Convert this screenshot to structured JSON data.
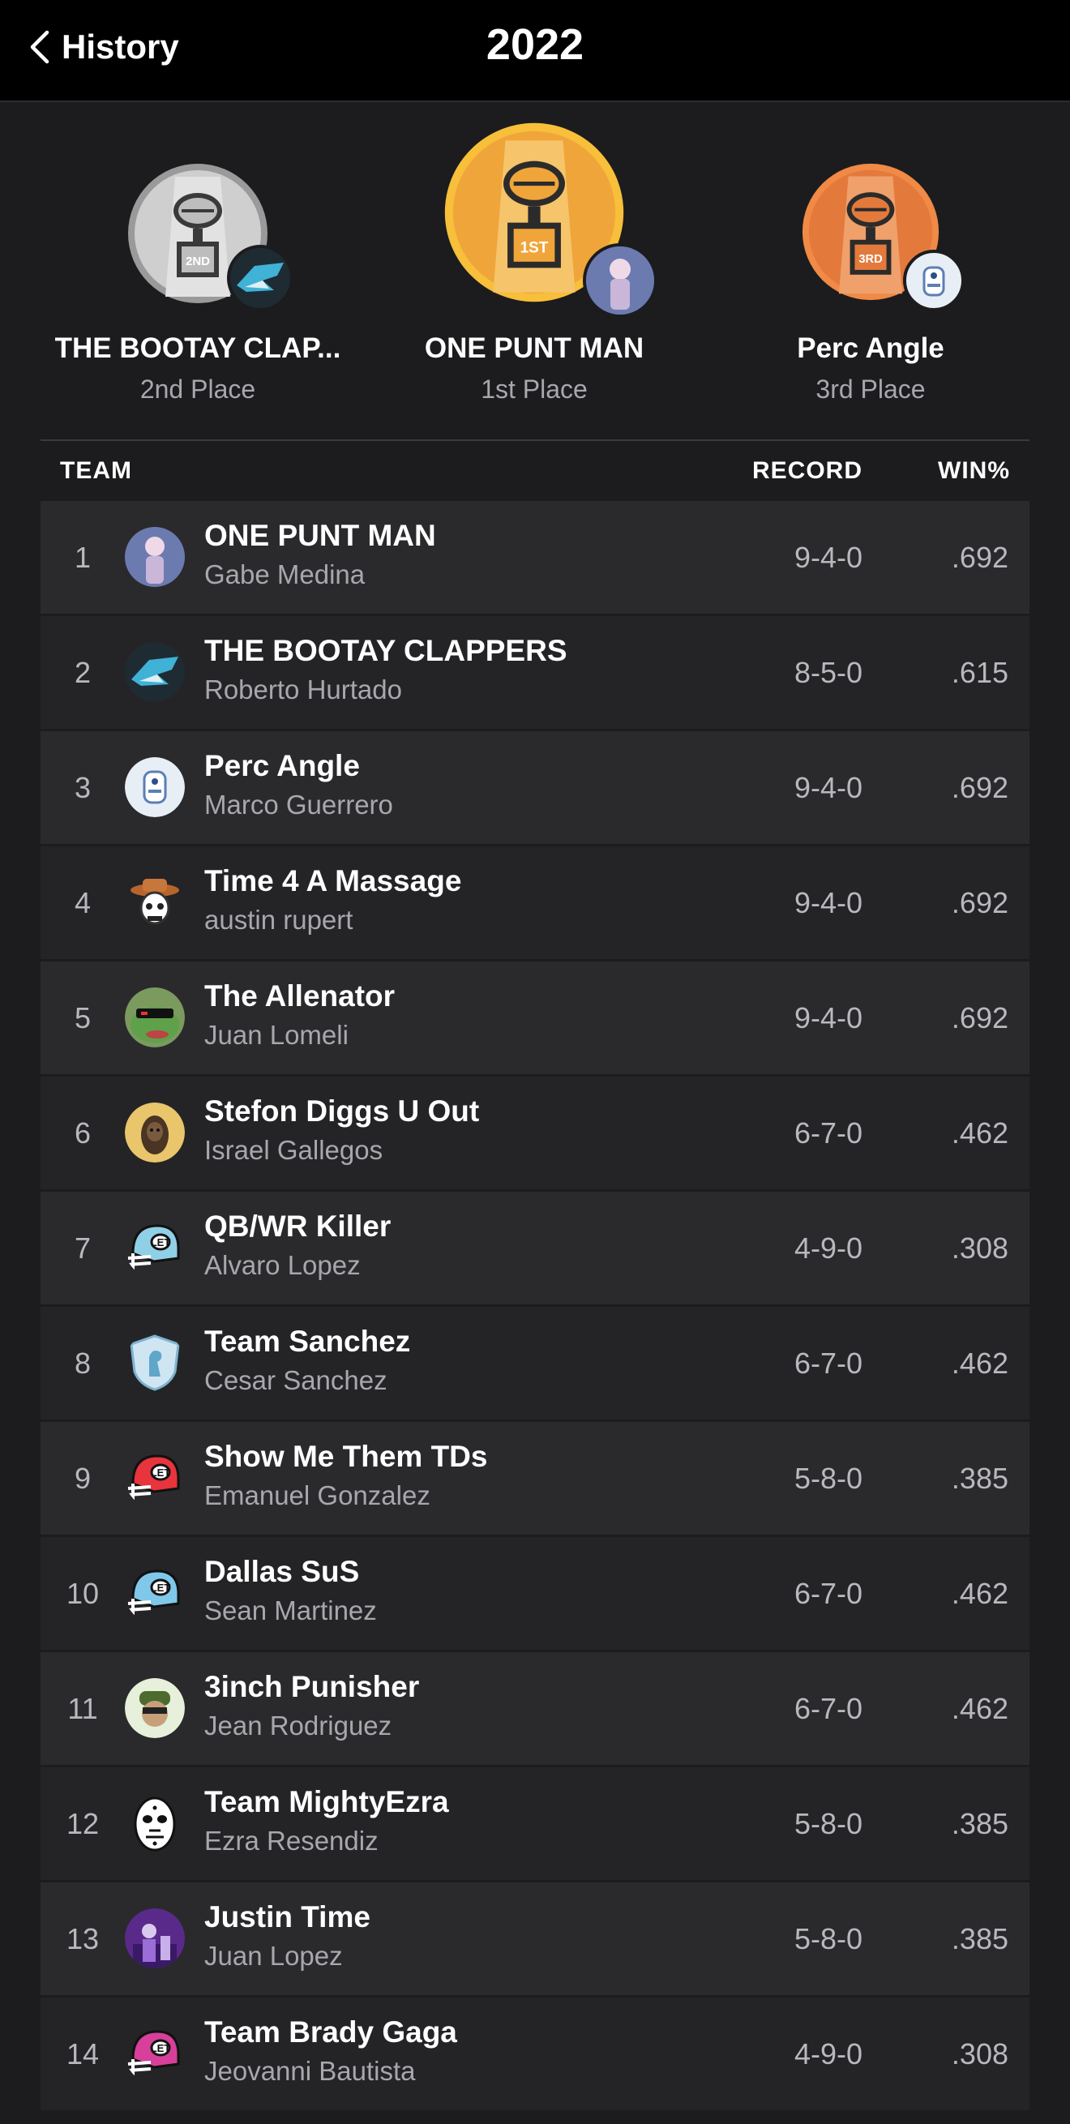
{
  "header": {
    "back_label": "History",
    "title": "2022"
  },
  "podium": [
    {
      "team": "THE BOOTAY CLAP...",
      "place": "2nd Place",
      "medal": "2ND",
      "color": "#bdbdbd"
    },
    {
      "team": "ONE PUNT MAN",
      "place": "1st Place",
      "medal": "1ST",
      "color": "#f0a53a"
    },
    {
      "team": "Perc Angle",
      "place": "3rd Place",
      "medal": "3RD",
      "color": "#e37a3b"
    }
  ],
  "table": {
    "headers": {
      "team": "TEAM",
      "record": "RECORD",
      "win_pct": "WIN%"
    },
    "rows": [
      {
        "rank": "1",
        "team": "ONE PUNT MAN",
        "owner": "Gabe Medina",
        "record": "9-4-0",
        "pct": ".692",
        "icon": "anime-avatar-icon"
      },
      {
        "rank": "2",
        "team": "THE BOOTAY CLAPPERS",
        "owner": "Roberto Hurtado",
        "record": "8-5-0",
        "pct": ".615",
        "icon": "shark-logo-icon"
      },
      {
        "rank": "3",
        "team": "Perc Angle",
        "owner": "Marco Guerrero",
        "record": "9-4-0",
        "pct": ".692",
        "icon": "robot-icon"
      },
      {
        "rank": "4",
        "team": "Time 4 A Massage",
        "owner": "austin rupert",
        "record": "9-4-0",
        "pct": ".692",
        "icon": "cowboy-skull-icon"
      },
      {
        "rank": "5",
        "team": "The Allenator",
        "owner": "Juan Lomeli",
        "record": "9-4-0",
        "pct": ".692",
        "icon": "frog-sunglasses-icon"
      },
      {
        "rank": "6",
        "team": "Stefon Diggs U Out",
        "owner": "Israel Gallegos",
        "record": "6-7-0",
        "pct": ".462",
        "icon": "wookiee-icon"
      },
      {
        "rank": "7",
        "team": "QB/WR Killer",
        "owner": "Alvaro Lopez",
        "record": "4-9-0",
        "pct": ".308",
        "icon": "helmet-icon"
      },
      {
        "rank": "8",
        "team": "Team Sanchez",
        "owner": "Cesar Sanchez",
        "record": "6-7-0",
        "pct": ".462",
        "icon": "shield-knight-icon"
      },
      {
        "rank": "9",
        "team": "Show Me Them TDs",
        "owner": "Emanuel Gonzalez",
        "record": "5-8-0",
        "pct": ".385",
        "icon": "helmet-icon"
      },
      {
        "rank": "10",
        "team": "Dallas SuS",
        "owner": "Sean Martinez",
        "record": "6-7-0",
        "pct": ".462",
        "icon": "helmet-icon"
      },
      {
        "rank": "11",
        "team": "3inch Punisher",
        "owner": "Jean Rodriguez",
        "record": "6-7-0",
        "pct": ".462",
        "icon": "soldier-icon"
      },
      {
        "rank": "12",
        "team": "Team MightyEzra",
        "owner": "Ezra Resendiz",
        "record": "5-8-0",
        "pct": ".385",
        "icon": "hockey-mask-icon"
      },
      {
        "rank": "13",
        "team": "Justin Time",
        "owner": "Juan Lopez",
        "record": "5-8-0",
        "pct": ".385",
        "icon": "player-photo-icon"
      },
      {
        "rank": "14",
        "team": "Team Brady Gaga",
        "owner": "Jeovanni Bautista",
        "record": "4-9-0",
        "pct": ".308",
        "icon": "helmet-icon"
      }
    ]
  }
}
